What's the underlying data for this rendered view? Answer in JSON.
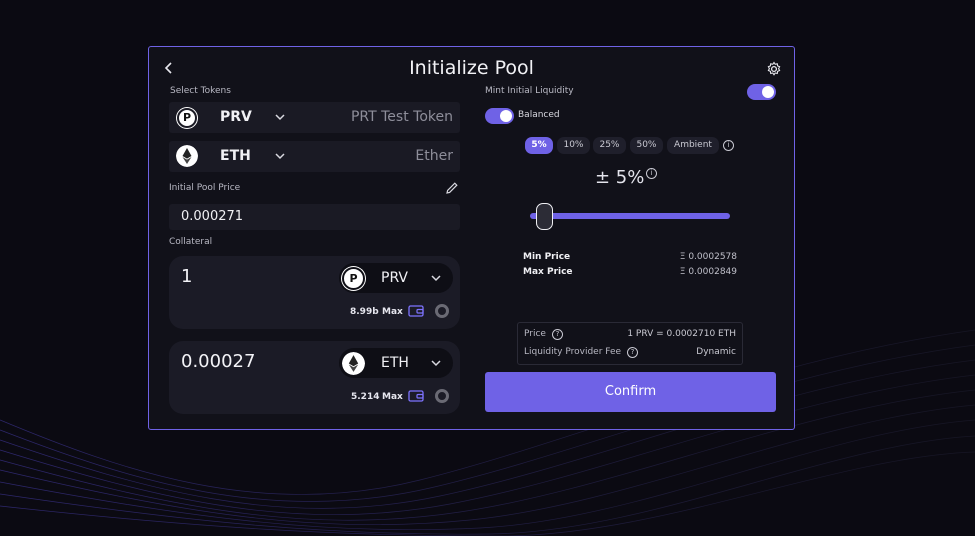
{
  "modal": {
    "title": "Initialize Pool",
    "select_tokens_label": "Select Tokens",
    "tokens": [
      {
        "symbol": "PRV",
        "name": "PRT Test Token",
        "icon": "prv-coin-icon"
      },
      {
        "symbol": "ETH",
        "name": "Ether",
        "icon": "eth-coin-icon"
      }
    ],
    "initial_price_label": "Initial Pool Price",
    "initial_price_value": "0.000271",
    "collateral_label": "Collateral",
    "collateral": [
      {
        "amount": "1",
        "symbol": "PRV",
        "balance": "8.99b",
        "max_label": "Max"
      },
      {
        "amount": "0.00027",
        "symbol": "ETH",
        "balance": "5.214",
        "max_label": "Max"
      }
    ]
  },
  "liquidity": {
    "mint_label": "Mint Initial Liquidity",
    "mint_enabled": true,
    "balanced_label": "Balanced",
    "balanced_enabled": true,
    "ranges": [
      "5%",
      "10%",
      "25%",
      "50%",
      "Ambient"
    ],
    "selected_range": "5%",
    "range_display": "± 5%",
    "min_price_label": "Min Price",
    "min_price_value": "Ξ 0.0002578",
    "max_price_label": "Max Price",
    "max_price_value": "Ξ 0.0002849",
    "price_label": "Price",
    "price_value": "1 PRV = 0.0002710 ETH",
    "fee_label": "Liquidity Provider Fee",
    "fee_value": "Dynamic",
    "confirm_label": "Confirm"
  },
  "colors": {
    "accent": "#6f62e6",
    "background": "#0b0a12",
    "panel": "#111119"
  }
}
